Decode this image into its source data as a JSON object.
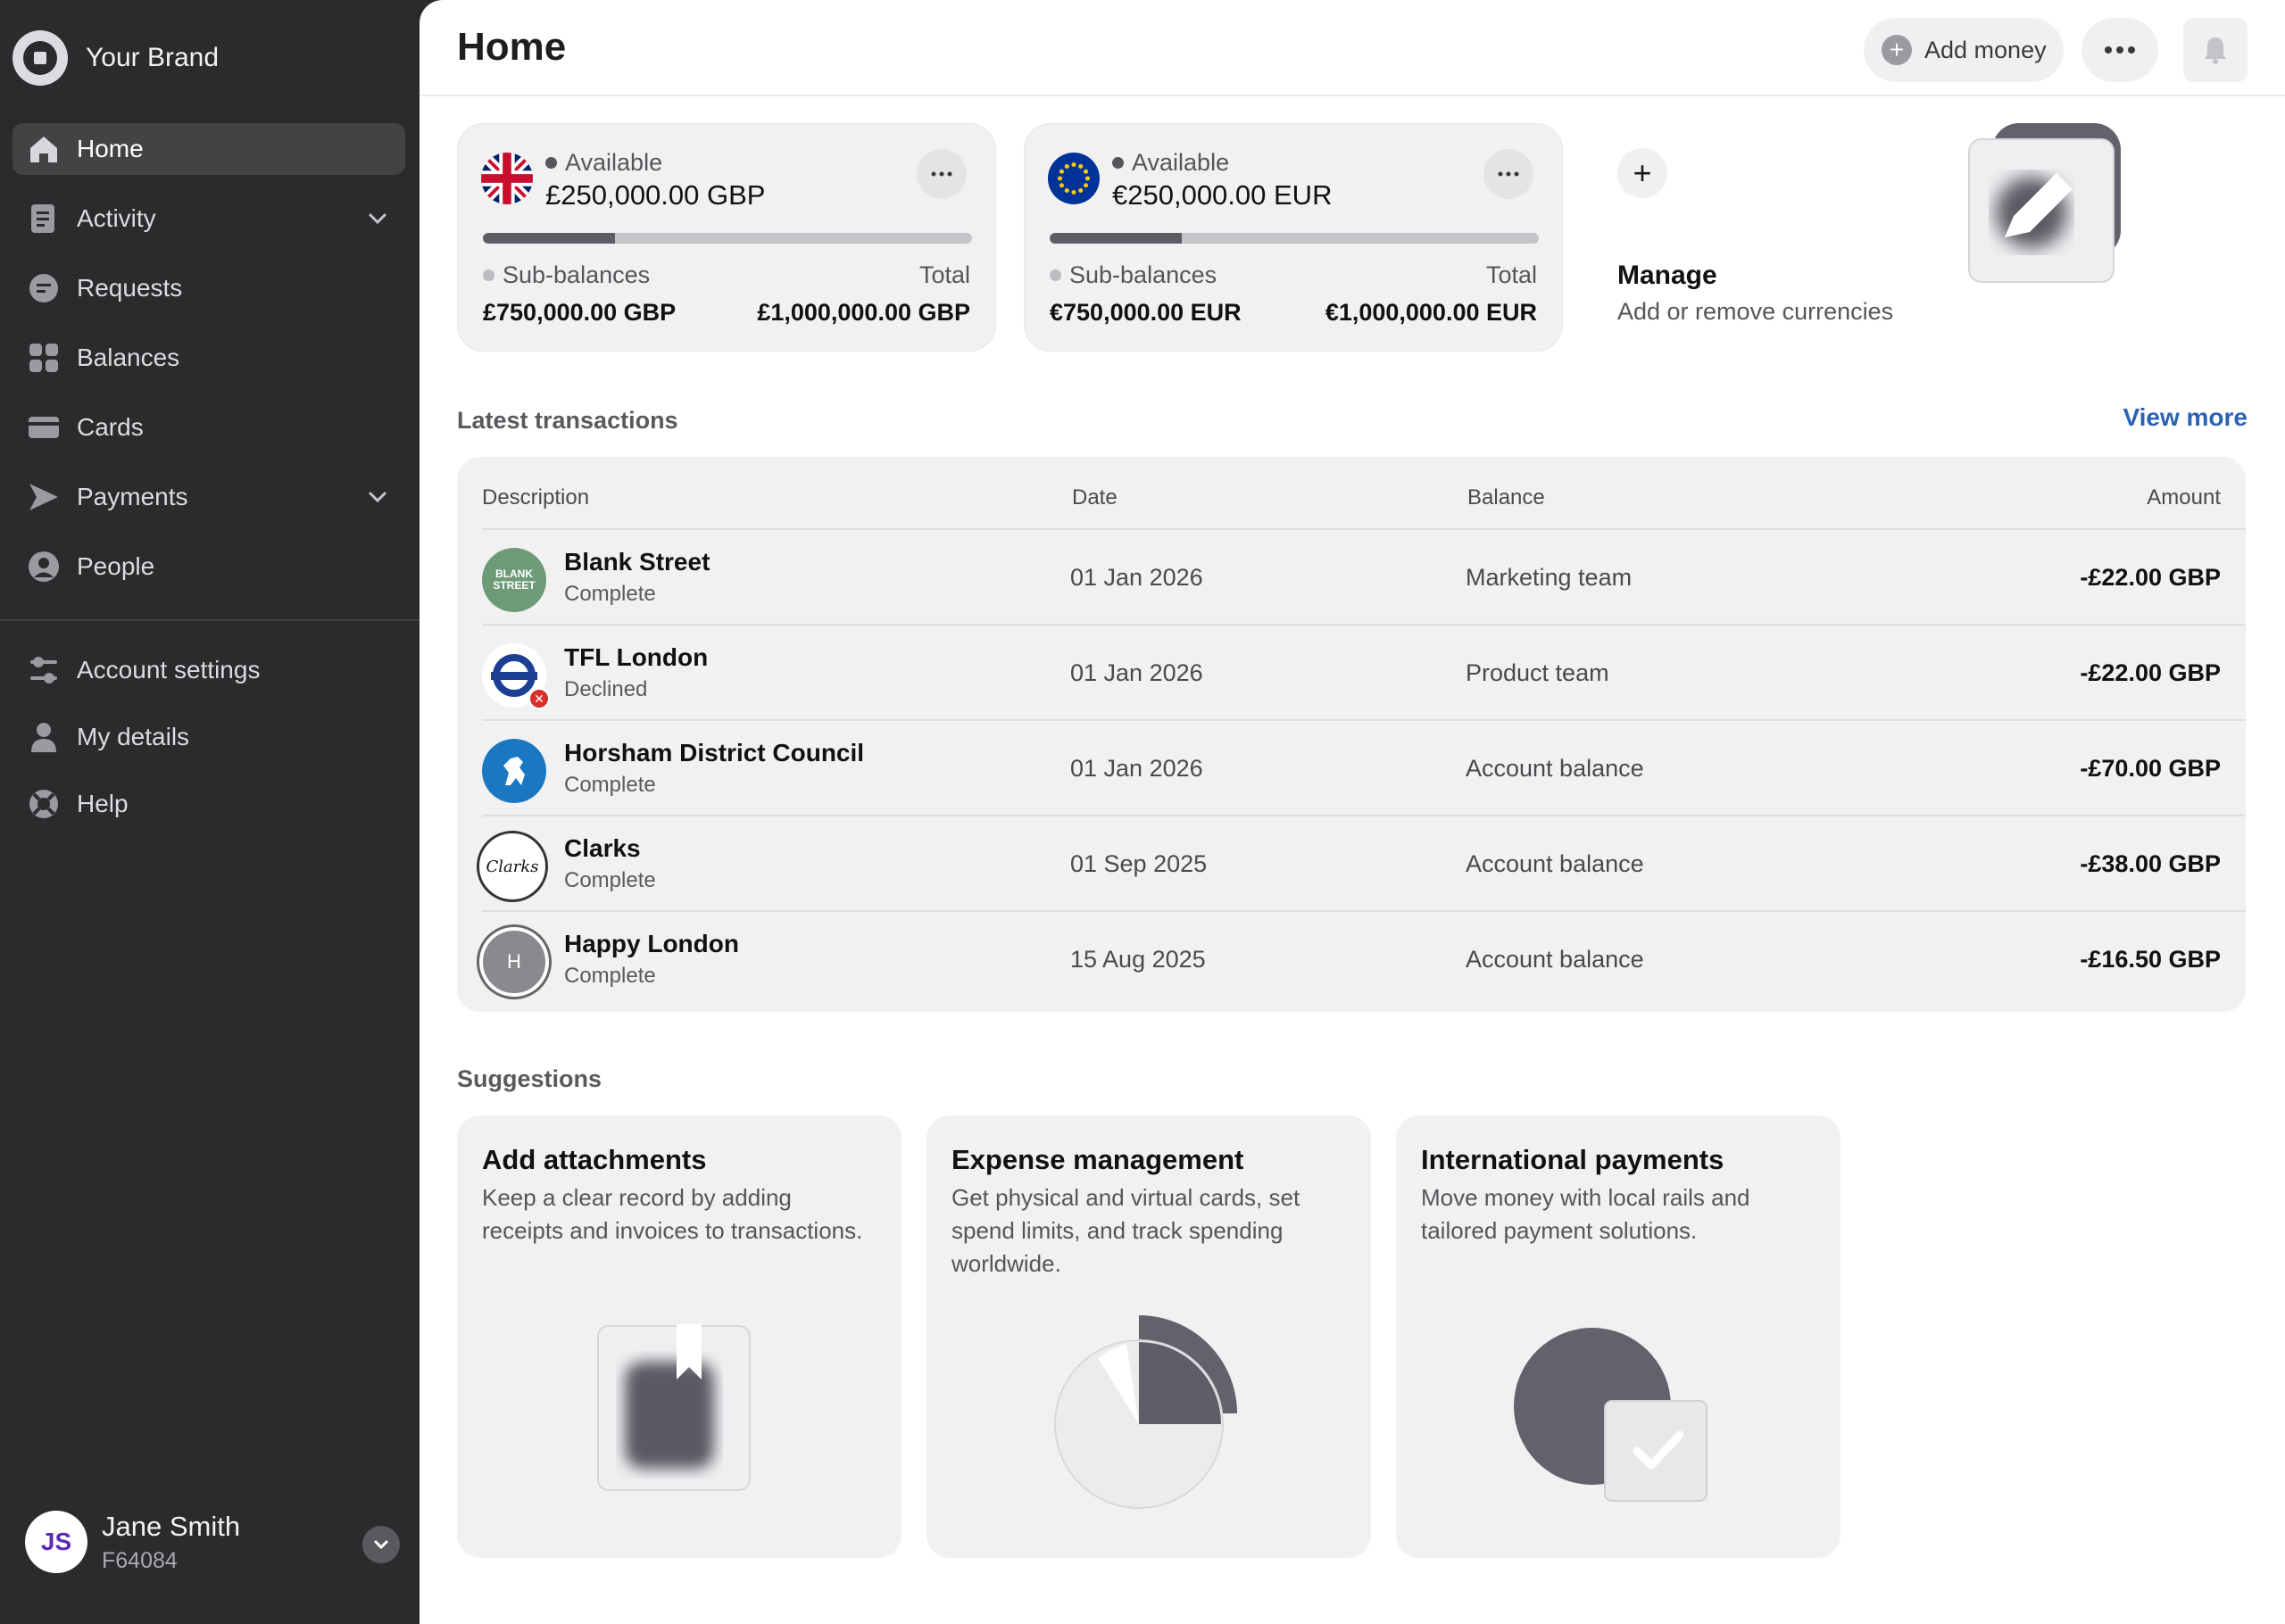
{
  "brand": {
    "name": "Your Brand"
  },
  "nav": {
    "items": [
      {
        "label": "Home",
        "icon": "home-icon"
      },
      {
        "label": "Activity",
        "icon": "activity-icon"
      },
      {
        "label": "Requests",
        "icon": "requests-icon"
      },
      {
        "label": "Balances",
        "icon": "balances-icon"
      },
      {
        "label": "Cards",
        "icon": "cards-icon"
      },
      {
        "label": "Payments",
        "icon": "payments-icon"
      },
      {
        "label": "People",
        "icon": "people-icon"
      }
    ],
    "secondary": [
      {
        "label": "Account settings",
        "icon": "settings-sliders-icon"
      },
      {
        "label": "My details",
        "icon": "person-icon"
      },
      {
        "label": "Help",
        "icon": "help-lifebuoy-icon"
      }
    ]
  },
  "user": {
    "initials": "JS",
    "name": "Jane Smith",
    "id": "F64084"
  },
  "header": {
    "title": "Home",
    "add_money": "Add money"
  },
  "balances": [
    {
      "currency": "GBP",
      "available_label": "Available",
      "available": "£250,000.00 GBP",
      "progress": 0.27,
      "sub_label": "Sub-balances",
      "sub": "£750,000.00 GBP",
      "total_label": "Total",
      "total": "£1,000,000.00 GBP"
    },
    {
      "currency": "EUR",
      "available_label": "Available",
      "available": "€250,000.00 EUR",
      "progress": 0.27,
      "sub_label": "Sub-balances",
      "sub": "€750,000.00 EUR",
      "total_label": "Total",
      "total": "€1,000,000.00 EUR"
    }
  ],
  "manage": {
    "title": "Manage",
    "subtitle": "Add or remove currencies"
  },
  "transactions": {
    "title": "Latest transactions",
    "view_more": "View more",
    "columns": [
      "Description",
      "Date",
      "Balance",
      "Amount"
    ],
    "rows": [
      {
        "name": "Blank Street",
        "status": "Complete",
        "date": "01 Jan 2026",
        "balance": "Marketing team",
        "amount": "-£22.00 GBP",
        "logo_text": "BLANK STREET"
      },
      {
        "name": "TFL London",
        "status": "Declined",
        "date": "01 Jan 2026",
        "balance": "Product team",
        "amount": "-£22.00 GBP"
      },
      {
        "name": "Horsham District Council",
        "status": "Complete",
        "date": "01 Jan 2026",
        "balance": "Account balance",
        "amount": "-£70.00 GBP"
      },
      {
        "name": "Clarks",
        "status": "Complete",
        "date": "01 Sep 2025",
        "balance": "Account balance",
        "amount": "-£38.00 GBP",
        "logo_text": "Clarks"
      },
      {
        "name": "Happy London",
        "status": "Complete",
        "date": "15 Aug 2025",
        "balance": "Account balance",
        "amount": "-£16.50 GBP",
        "logo_text": "H"
      }
    ]
  },
  "suggestions": {
    "title": "Suggestions",
    "cards": [
      {
        "title": "Add attachments",
        "desc": "Keep a clear record by adding receipts and invoices to transactions."
      },
      {
        "title": "Expense management",
        "desc": "Get physical and virtual cards, set spend limits, and track spending worldwide."
      },
      {
        "title": "International payments",
        "desc": "Move money with local rails and tailored payment solutions."
      }
    ]
  },
  "colors": {
    "sidebar": "#2b2b2d",
    "accent_link": "#2a63b4",
    "avatar_text": "#5b2bb5",
    "declined": "#d9302c"
  }
}
